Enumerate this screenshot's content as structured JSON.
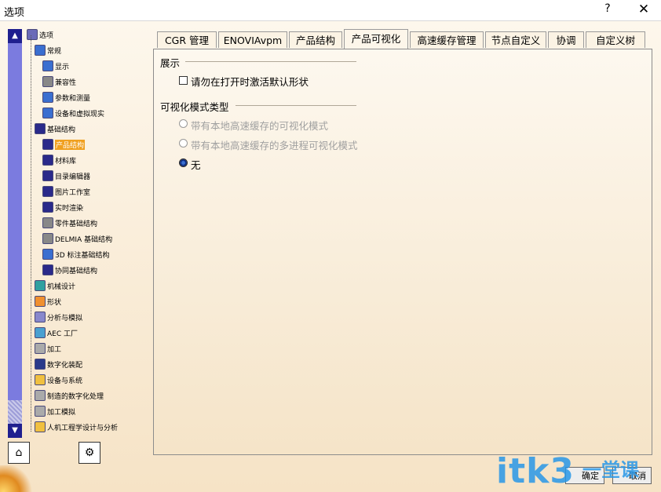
{
  "window": {
    "title": "选项",
    "help": "?",
    "close": "✕"
  },
  "tree": {
    "items": [
      {
        "label": "选项",
        "icon": "options-icon",
        "color": "#6b6bb8"
      },
      {
        "label": "常规",
        "icon": "general-icon",
        "color": "#3a6fd0"
      },
      {
        "label": "显示",
        "icon": "display-icon",
        "color": "#3a6fd0"
      },
      {
        "label": "兼容性",
        "icon": "compatibility-icon",
        "color": "#888888"
      },
      {
        "label": "参数和测量",
        "icon": "parameters-icon",
        "color": "#3a6fd0"
      },
      {
        "label": "设备和虚拟现实",
        "icon": "devices-icon",
        "color": "#3a6fd0"
      },
      {
        "label": "基础结构",
        "icon": "infrastructure-icon",
        "color": "#2a2a8a"
      },
      {
        "label": "产品结构",
        "icon": "product-structure-icon",
        "color": "#2a2a8a"
      },
      {
        "label": "材料库",
        "icon": "material-library-icon",
        "color": "#2a2a8a"
      },
      {
        "label": "目录编辑器",
        "icon": "catalog-editor-icon",
        "color": "#2a2a8a"
      },
      {
        "label": "图片工作室",
        "icon": "photo-studio-icon",
        "color": "#2a2a8a"
      },
      {
        "label": "实时渲染",
        "icon": "realtime-rendering-icon",
        "color": "#2a2a8a"
      },
      {
        "label": "零件基础结构",
        "icon": "part-infrastructure-icon",
        "color": "#888888"
      },
      {
        "label": "DELMIA 基础结构",
        "icon": "delmia-icon",
        "color": "#888888"
      },
      {
        "label": "3D 标注基础结构",
        "icon": "annotation-3d-icon",
        "color": "#3a6fd0"
      },
      {
        "label": "协同基础结构",
        "icon": "collaboration-icon",
        "color": "#2a2a8a"
      },
      {
        "label": "机械设计",
        "icon": "mechanical-design-icon",
        "color": "#30a0a0"
      },
      {
        "label": "形状",
        "icon": "shape-icon",
        "color": "#f09030"
      },
      {
        "label": "分析与模拟",
        "icon": "analysis-icon",
        "color": "#8888cc"
      },
      {
        "label": "AEC 工厂",
        "icon": "aec-plant-icon",
        "color": "#4aa0d0"
      },
      {
        "label": "加工",
        "icon": "machining-icon",
        "color": "#aaaaaa"
      },
      {
        "label": "数字化装配",
        "icon": "digital-mockup-icon",
        "color": "#2a3a8a"
      },
      {
        "label": "设备与系统",
        "icon": "equipment-icon",
        "color": "#f0c040"
      },
      {
        "label": "制造的数字化处理",
        "icon": "manufacturing-icon",
        "color": "#aaaaaa"
      },
      {
        "label": "加工模拟",
        "icon": "machining-simulation-icon",
        "color": "#aaaaaa"
      },
      {
        "label": "人机工程学设计与分析",
        "icon": "ergonomics-icon",
        "color": "#f0c040"
      }
    ],
    "selected_index": 7,
    "scroll_up": "▲",
    "scroll_down": "▼"
  },
  "tabs": [
    {
      "label": "CGR 管理"
    },
    {
      "label": "ENOVIAvpm"
    },
    {
      "label": "产品结构"
    },
    {
      "label": "产品可视化"
    },
    {
      "label": "高速缓存管理"
    },
    {
      "label": "节点自定义"
    },
    {
      "label": "协调"
    },
    {
      "label": "自定义树"
    }
  ],
  "active_tab": 3,
  "display_group": {
    "title": "展示",
    "checkbox_label": "请勿在打开时激活默认形状",
    "checked": false
  },
  "mode_group": {
    "title": "可视化模式类型",
    "options": [
      {
        "label": "带有本地高速缓存的可视化模式",
        "enabled": false,
        "selected": false
      },
      {
        "label": "带有本地高速缓存的多进程可视化模式",
        "enabled": false,
        "selected": false
      },
      {
        "label": "无",
        "enabled": true,
        "selected": true
      }
    ]
  },
  "footer": {
    "ok": "确定",
    "cancel": "取消"
  },
  "watermark": {
    "text": "itk3",
    "cn": "一堂课"
  }
}
